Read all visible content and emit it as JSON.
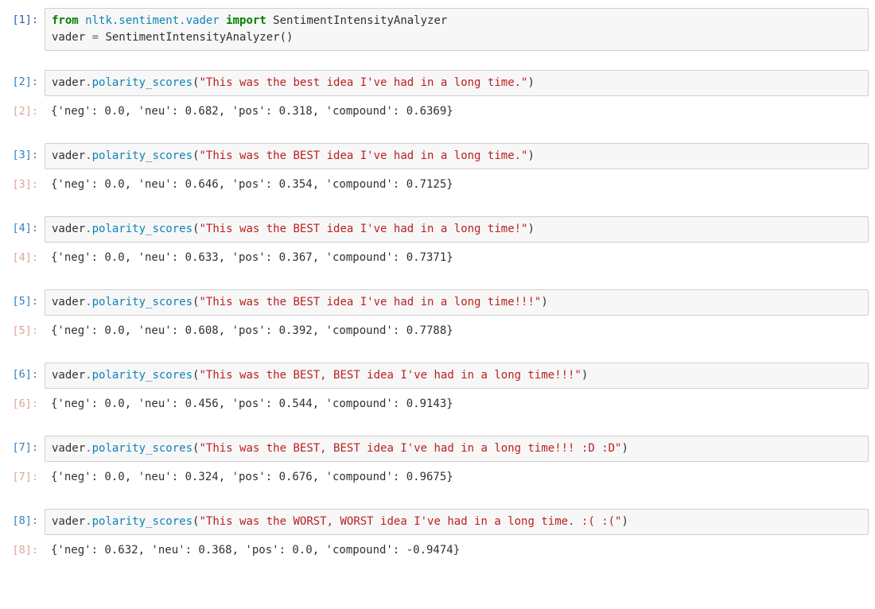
{
  "cells": [
    {
      "n": "1",
      "type": "in",
      "first": true,
      "lines": [
        [
          {
            "t": "from ",
            "cls": "k-from"
          },
          {
            "t": "nltk.sentiment.vader",
            "cls": "mod"
          },
          {
            "t": " import ",
            "cls": "k-import"
          },
          {
            "t": "SentimentIntensityAnalyzer",
            "cls": "cls"
          }
        ],
        [
          {
            "t": "vader ",
            "cls": "obj"
          },
          {
            "t": "=",
            "cls": "op"
          },
          {
            "t": " SentimentIntensityAnalyzer()",
            "cls": "cls"
          }
        ]
      ]
    },
    {
      "n": "2",
      "type": "in",
      "lines": [
        [
          {
            "t": "vader",
            "cls": "obj"
          },
          {
            "t": ".",
            "cls": "op"
          },
          {
            "t": "polarity_scores",
            "cls": "meth"
          },
          {
            "t": "(",
            "cls": "paren"
          },
          {
            "t": "\"This was the best idea I've had in a long time.\"",
            "cls": "str"
          },
          {
            "t": ")",
            "cls": "paren"
          }
        ]
      ]
    },
    {
      "n": "2",
      "type": "out",
      "text": "{'neg': 0.0, 'neu': 0.682, 'pos': 0.318, 'compound': 0.6369}"
    },
    {
      "n": "3",
      "type": "in",
      "lines": [
        [
          {
            "t": "vader",
            "cls": "obj"
          },
          {
            "t": ".",
            "cls": "op"
          },
          {
            "t": "polarity_scores",
            "cls": "meth"
          },
          {
            "t": "(",
            "cls": "paren"
          },
          {
            "t": "\"This was the BEST idea I've had in a long time.\"",
            "cls": "str"
          },
          {
            "t": ")",
            "cls": "paren"
          }
        ]
      ]
    },
    {
      "n": "3",
      "type": "out",
      "text": "{'neg': 0.0, 'neu': 0.646, 'pos': 0.354, 'compound': 0.7125}"
    },
    {
      "n": "4",
      "type": "in",
      "lines": [
        [
          {
            "t": "vader",
            "cls": "obj"
          },
          {
            "t": ".",
            "cls": "op"
          },
          {
            "t": "polarity_scores",
            "cls": "meth"
          },
          {
            "t": "(",
            "cls": "paren"
          },
          {
            "t": "\"This was the BEST idea I've had in a long time!\"",
            "cls": "str"
          },
          {
            "t": ")",
            "cls": "paren"
          }
        ]
      ]
    },
    {
      "n": "4",
      "type": "out",
      "text": "{'neg': 0.0, 'neu': 0.633, 'pos': 0.367, 'compound': 0.7371}"
    },
    {
      "n": "5",
      "type": "in",
      "lines": [
        [
          {
            "t": "vader",
            "cls": "obj"
          },
          {
            "t": ".",
            "cls": "op"
          },
          {
            "t": "polarity_scores",
            "cls": "meth"
          },
          {
            "t": "(",
            "cls": "paren"
          },
          {
            "t": "\"This was the BEST idea I've had in a long time!!!\"",
            "cls": "str"
          },
          {
            "t": ")",
            "cls": "paren"
          }
        ]
      ]
    },
    {
      "n": "5",
      "type": "out",
      "text": "{'neg': 0.0, 'neu': 0.608, 'pos': 0.392, 'compound': 0.7788}"
    },
    {
      "n": "6",
      "type": "in",
      "lines": [
        [
          {
            "t": "vader",
            "cls": "obj"
          },
          {
            "t": ".",
            "cls": "op"
          },
          {
            "t": "polarity_scores",
            "cls": "meth"
          },
          {
            "t": "(",
            "cls": "paren"
          },
          {
            "t": "\"This was the BEST, BEST idea I've had in a long time!!!\"",
            "cls": "str"
          },
          {
            "t": ")",
            "cls": "paren"
          }
        ]
      ]
    },
    {
      "n": "6",
      "type": "out",
      "text": "{'neg': 0.0, 'neu': 0.456, 'pos': 0.544, 'compound': 0.9143}"
    },
    {
      "n": "7",
      "type": "in",
      "lines": [
        [
          {
            "t": "vader",
            "cls": "obj"
          },
          {
            "t": ".",
            "cls": "op"
          },
          {
            "t": "polarity_scores",
            "cls": "meth"
          },
          {
            "t": "(",
            "cls": "paren"
          },
          {
            "t": "\"This was the BEST, BEST idea I've had in a long time!!! :D :D\"",
            "cls": "str"
          },
          {
            "t": ")",
            "cls": "paren"
          }
        ]
      ]
    },
    {
      "n": "7",
      "type": "out",
      "text": "{'neg': 0.0, 'neu': 0.324, 'pos': 0.676, 'compound': 0.9675}"
    },
    {
      "n": "8",
      "type": "in",
      "lines": [
        [
          {
            "t": "vader",
            "cls": "obj"
          },
          {
            "t": ".",
            "cls": "op"
          },
          {
            "t": "polarity_scores",
            "cls": "meth"
          },
          {
            "t": "(",
            "cls": "paren"
          },
          {
            "t": "\"This was the WORST, WORST idea I've had in a long time. :( :(\"",
            "cls": "str"
          },
          {
            "t": ")",
            "cls": "paren"
          }
        ]
      ]
    },
    {
      "n": "8",
      "type": "out",
      "text": "{'neg': 0.632, 'neu': 0.368, 'pos': 0.0, 'compound': -0.9474}"
    }
  ]
}
